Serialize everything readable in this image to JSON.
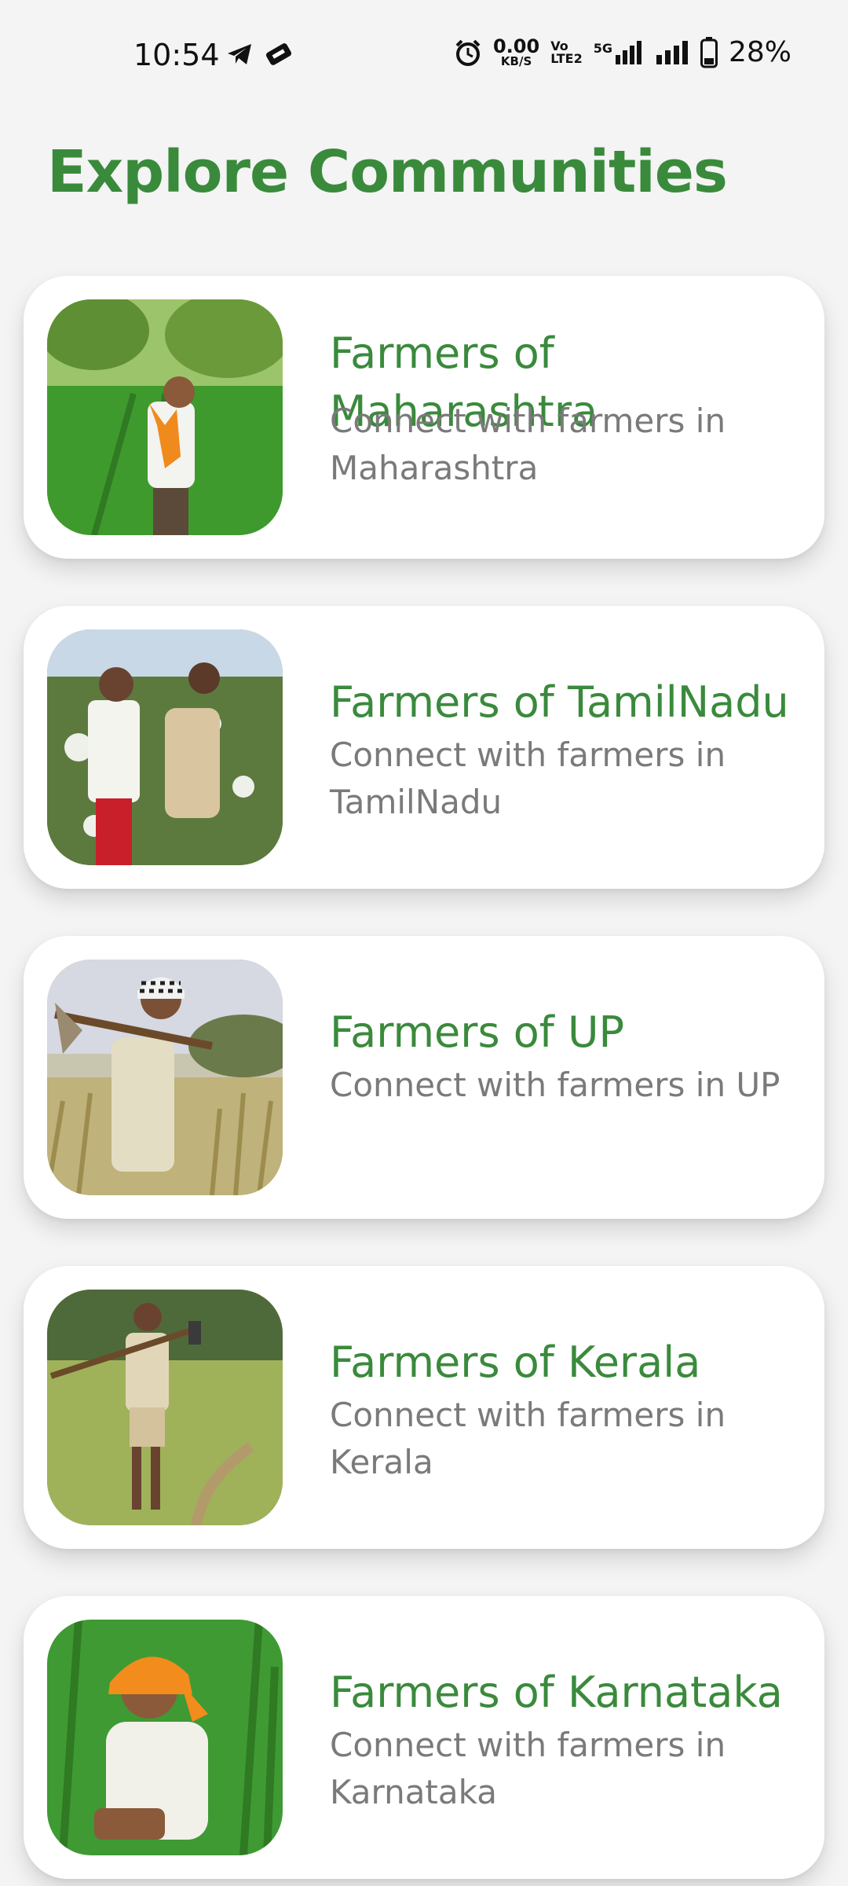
{
  "status": {
    "time": "10:54",
    "net_speed_value": "0.00",
    "net_speed_unit": "KB/S",
    "volte_top": "Vo",
    "volte_bottom": "LTE2",
    "network": "5G",
    "battery": "28%"
  },
  "page": {
    "title": "Explore Communities"
  },
  "communities": [
    {
      "title": "Farmers of Maharashtra",
      "subtitle": "Connect with farmers in Maharashtra"
    },
    {
      "title": "Farmers of TamilNadu",
      "subtitle": "Connect with farmers in TamilNadu"
    },
    {
      "title": "Farmers of UP",
      "subtitle": "Connect with farmers in UP"
    },
    {
      "title": "Farmers of Kerala",
      "subtitle": "Connect with farmers in Kerala"
    },
    {
      "title": "Farmers of Karnataka",
      "subtitle": "Connect with farmers in Karnataka"
    }
  ],
  "colors": {
    "accent": "#3a8a3c",
    "subtitle": "#7a7a7a",
    "background": "#f4f4f4"
  }
}
